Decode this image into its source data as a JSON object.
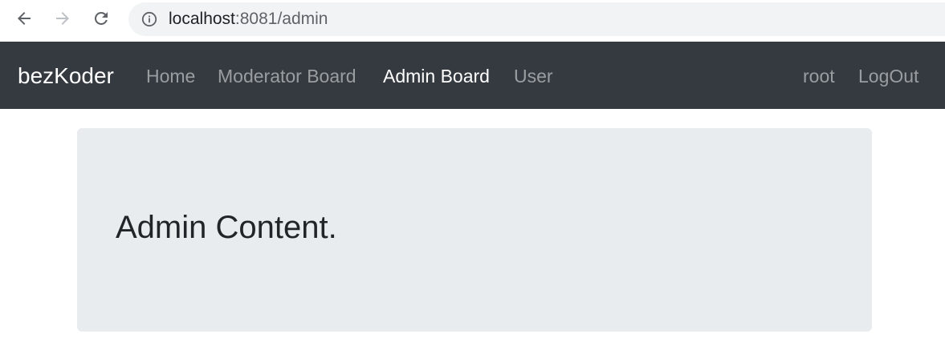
{
  "browser": {
    "url_host": "localhost",
    "url_rest": ":8081/admin",
    "icons": {
      "back": "arrow-left-icon",
      "forward": "arrow-right-icon",
      "reload": "reload-icon",
      "info": "info-icon"
    }
  },
  "navbar": {
    "brand": "bezKoder",
    "links": [
      {
        "label": "Home",
        "active": false
      },
      {
        "label": "Moderator Board",
        "active": false
      },
      {
        "label": "Admin Board",
        "active": true
      },
      {
        "label": "User",
        "active": false
      }
    ],
    "right_links": [
      {
        "label": "root"
      },
      {
        "label": "LogOut"
      }
    ],
    "background_color": "#343a40"
  },
  "main": {
    "heading": "Admin Content.",
    "jumbotron_color": "#e9ecef"
  }
}
